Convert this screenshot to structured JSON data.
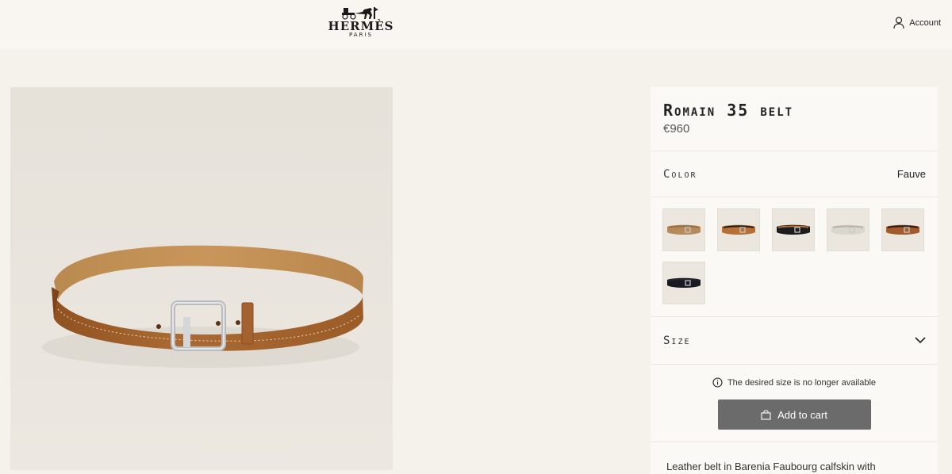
{
  "header": {
    "brand": "HERMÈS",
    "brand_sub": "PARIS",
    "account_label": "Account"
  },
  "product": {
    "title": "Romain 35 belt",
    "price": "€960",
    "color_label": "Color",
    "color_value": "Fauve",
    "swatches": [
      {
        "colors": [
          "#b68a5a",
          "#9a6e44"
        ]
      },
      {
        "colors": [
          "#b76f35",
          "#1e1e1e"
        ]
      },
      {
        "colors": [
          "#1c1c1c",
          "#b76f35"
        ]
      },
      {
        "colors": [
          "#d9d6cb",
          "#b6b2a8"
        ]
      },
      {
        "colors": [
          "#a55a2c",
          "#1e1e1e"
        ]
      },
      {
        "colors": [
          "#1a1a24",
          "#23232d"
        ]
      }
    ],
    "size_label": "Size",
    "size_notice": "The desired size is no longer available",
    "add_to_cart_label": "Add to cart",
    "description": "Leather belt in Barenia Faubourg calfskin with"
  },
  "colors": {
    "background": "#f5f1eb",
    "panel": "#fbf9f6",
    "button": "#6b6b6b",
    "belt_leather": "#a8652c"
  }
}
